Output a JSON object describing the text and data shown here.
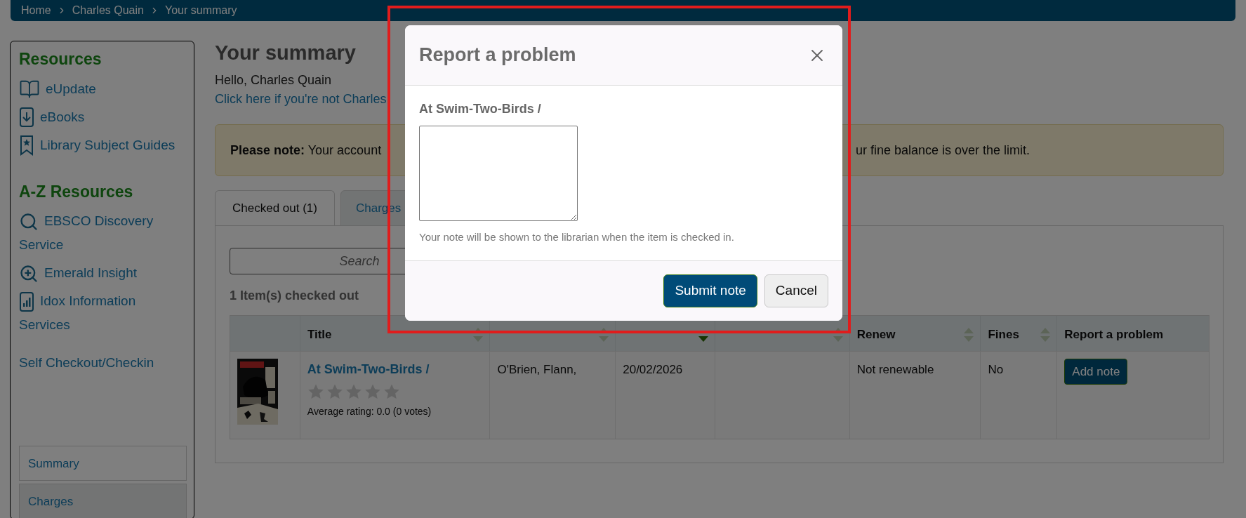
{
  "breadcrumbs": [
    "Home",
    "Charles Quain",
    "Your summary"
  ],
  "sidebar": {
    "sections": [
      {
        "heading": "Resources",
        "items": [
          {
            "label": "eUpdate"
          },
          {
            "label": "eBooks"
          },
          {
            "label": "Library Subject Guides"
          }
        ]
      },
      {
        "heading": "A-Z Resources",
        "items": [
          {
            "label": "EBSCO Discovery Service"
          },
          {
            "label": "Emerald Insight"
          },
          {
            "label": "Idox Information Services"
          },
          {
            "label": "Self Checkout/Checkin"
          }
        ]
      }
    ],
    "nav": [
      {
        "label": "Summary",
        "selected": true
      },
      {
        "label": "Charges",
        "selected": false
      }
    ]
  },
  "page": {
    "title": "Your summary",
    "greeting": "Hello, Charles Quain",
    "not_you_link": "Click here if you're not Charles",
    "notice": {
      "left": "**Please note:** Your account",
      "right": "ur fine balance is over the limit."
    },
    "tabs": [
      {
        "label": "Checked out (1)",
        "selected": true
      },
      {
        "label": "Charges",
        "selected": false
      }
    ],
    "search": {
      "placeholder": "Search"
    },
    "count": "1 Item(s) checked out",
    "table": {
      "columns": [
        {},
        {
          "label": "Title",
          "sortable": true,
          "sorted": false
        },
        {
          "sortable": true,
          "sorted": false
        },
        {
          "sortable": true,
          "sorted": true
        },
        {
          "sortable": true,
          "sorted": false
        },
        {
          "label": "Renew",
          "sortable": true,
          "sorted": false
        },
        {
          "label": "Fines",
          "sortable": true,
          "sorted": false
        },
        {
          "label": "Report a problem"
        }
      ],
      "rows": [
        {
          "title": "At Swim-Two-Birds /",
          "stars": 0,
          "rating": "Average rating: 0.0 (0 votes)",
          "author": "O'Brien, Flann,",
          "due": "20/02/2026",
          "renew": "Not renewable",
          "fines": "No",
          "action": "Add note"
        }
      ]
    }
  },
  "modal": {
    "title": "Report a problem",
    "item_title": "At Swim-Two-Birds /",
    "hint": "Your note will be shown to the librarian when the item is checked in.",
    "buttons": [
      {
        "label": "Submit note",
        "kind": "primary"
      },
      {
        "label": "Cancel",
        "kind": "secondary"
      }
    ]
  }
}
